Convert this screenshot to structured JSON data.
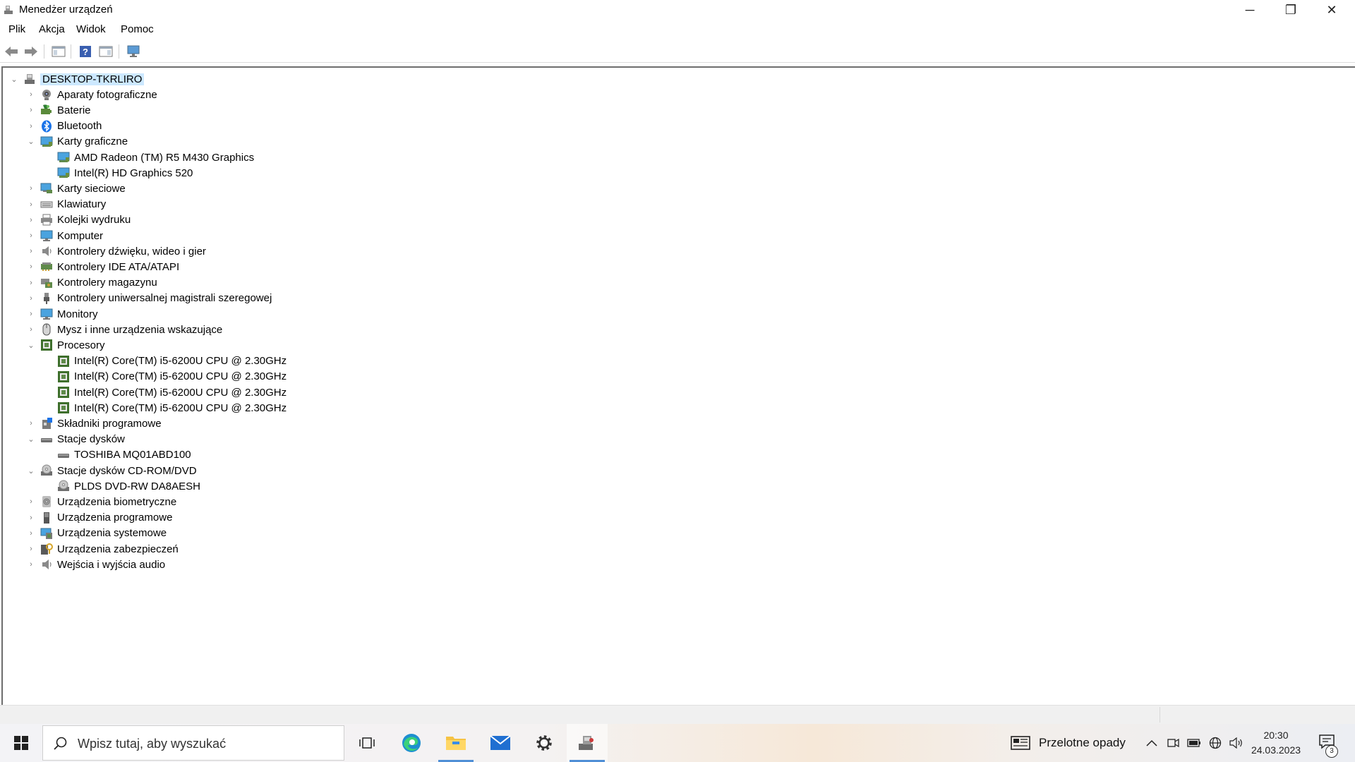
{
  "window": {
    "title": "Menedżer urządzeń",
    "controls": {
      "minimize": "─",
      "maximize": "❐",
      "close": "✕"
    }
  },
  "menubar": {
    "items": [
      {
        "label": "Plik",
        "name": "menu-file"
      },
      {
        "label": "Akcja",
        "name": "menu-action"
      },
      {
        "label": "Widok",
        "name": "menu-view"
      },
      {
        "label": "Pomoc",
        "name": "menu-help"
      }
    ]
  },
  "toolbar": {
    "buttons": [
      "back-icon",
      "forward-icon",
      "show-hide-console-tree-icon",
      "help-icon",
      "properties-pane-icon",
      "scan-hardware-icon"
    ]
  },
  "tree": {
    "root": {
      "label": "DESKTOP-TKRLIRO",
      "expanded": true,
      "icon": "computer-icon"
    },
    "nodes": [
      {
        "label": "Aparaty fotograficzne",
        "level": 1,
        "state": "collapsed",
        "icon": "camera-icon"
      },
      {
        "label": "Baterie",
        "level": 1,
        "state": "collapsed",
        "icon": "battery-icon"
      },
      {
        "label": "Bluetooth",
        "level": 1,
        "state": "collapsed",
        "icon": "bluetooth-icon"
      },
      {
        "label": "Karty graficzne",
        "level": 1,
        "state": "expanded",
        "icon": "display-adapter-icon"
      },
      {
        "label": "AMD Radeon (TM) R5 M430 Graphics",
        "level": 2,
        "state": "leaf",
        "icon": "display-adapter-icon"
      },
      {
        "label": "Intel(R) HD Graphics 520",
        "level": 2,
        "state": "leaf",
        "icon": "display-adapter-icon"
      },
      {
        "label": "Karty sieciowe",
        "level": 1,
        "state": "collapsed",
        "icon": "network-adapter-icon"
      },
      {
        "label": "Klawiatury",
        "level": 1,
        "state": "collapsed",
        "icon": "keyboard-icon"
      },
      {
        "label": "Kolejki wydruku",
        "level": 1,
        "state": "collapsed",
        "icon": "printer-icon"
      },
      {
        "label": "Komputer",
        "level": 1,
        "state": "collapsed",
        "icon": "monitor-icon"
      },
      {
        "label": "Kontrolery dźwięku, wideo i gier",
        "level": 1,
        "state": "collapsed",
        "icon": "speaker-icon"
      },
      {
        "label": "Kontrolery IDE ATA/ATAPI",
        "level": 1,
        "state": "collapsed",
        "icon": "ide-controller-icon"
      },
      {
        "label": "Kontrolery magazynu",
        "level": 1,
        "state": "collapsed",
        "icon": "storage-controller-icon"
      },
      {
        "label": "Kontrolery uniwersalnej magistrali szeregowej",
        "level": 1,
        "state": "collapsed",
        "icon": "usb-icon"
      },
      {
        "label": "Monitory",
        "level": 1,
        "state": "collapsed",
        "icon": "monitor-icon"
      },
      {
        "label": "Mysz i inne urządzenia wskazujące",
        "level": 1,
        "state": "collapsed",
        "icon": "mouse-icon"
      },
      {
        "label": "Procesory",
        "level": 1,
        "state": "expanded",
        "icon": "processor-icon"
      },
      {
        "label": "Intel(R) Core(TM) i5-6200U CPU @ 2.30GHz",
        "level": 2,
        "state": "leaf",
        "icon": "processor-icon"
      },
      {
        "label": "Intel(R) Core(TM) i5-6200U CPU @ 2.30GHz",
        "level": 2,
        "state": "leaf",
        "icon": "processor-icon"
      },
      {
        "label": "Intel(R) Core(TM) i5-6200U CPU @ 2.30GHz",
        "level": 2,
        "state": "leaf",
        "icon": "processor-icon"
      },
      {
        "label": "Intel(R) Core(TM) i5-6200U CPU @ 2.30GHz",
        "level": 2,
        "state": "leaf",
        "icon": "processor-icon"
      },
      {
        "label": "Składniki programowe",
        "level": 1,
        "state": "collapsed",
        "icon": "software-component-icon"
      },
      {
        "label": "Stacje dysków",
        "level": 1,
        "state": "expanded",
        "icon": "disk-drive-icon"
      },
      {
        "label": "TOSHIBA MQ01ABD100",
        "level": 2,
        "state": "leaf",
        "icon": "disk-drive-icon"
      },
      {
        "label": "Stacje dysków CD-ROM/DVD",
        "level": 1,
        "state": "expanded",
        "icon": "dvd-drive-icon"
      },
      {
        "label": "PLDS DVD-RW DA8AESH",
        "level": 2,
        "state": "leaf",
        "icon": "dvd-drive-icon"
      },
      {
        "label": "Urządzenia biometryczne",
        "level": 1,
        "state": "collapsed",
        "icon": "fingerprint-icon"
      },
      {
        "label": "Urządzenia programowe",
        "level": 1,
        "state": "collapsed",
        "icon": "software-device-icon"
      },
      {
        "label": "Urządzenia systemowe",
        "level": 1,
        "state": "collapsed",
        "icon": "system-device-icon"
      },
      {
        "label": "Urządzenia zabezpieczeń",
        "level": 1,
        "state": "collapsed",
        "icon": "security-device-icon"
      },
      {
        "label": "Wejścia i wyjścia audio",
        "level": 1,
        "state": "collapsed",
        "icon": "audio-io-icon"
      }
    ]
  },
  "taskbar": {
    "search_placeholder": "Wpisz tutaj, aby wyszukać",
    "apps": [
      {
        "name": "task-view-button",
        "icon": "task-view-icon"
      },
      {
        "name": "edge-button",
        "icon": "edge-icon"
      },
      {
        "name": "file-explorer-button",
        "icon": "folder-icon"
      },
      {
        "name": "mail-button",
        "icon": "mail-icon"
      },
      {
        "name": "settings-button",
        "icon": "gear-icon"
      },
      {
        "name": "device-manager-button",
        "icon": "device-manager-icon"
      }
    ],
    "weather": "Przelotne opady",
    "time": "20:30",
    "date": "24.03.2023",
    "notifications": "3"
  },
  "colors": {
    "selection": "#cce8ff",
    "accent": "#4f8fd6"
  }
}
